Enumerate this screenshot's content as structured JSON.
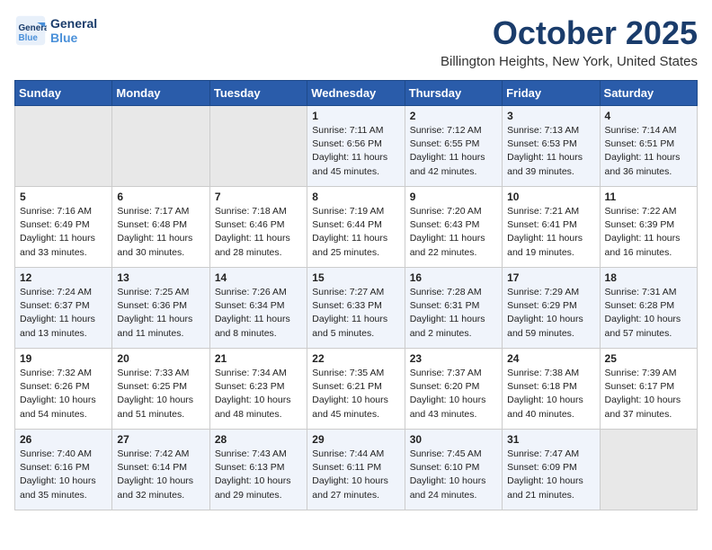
{
  "logo": {
    "line1": "General",
    "line2": "Blue"
  },
  "title": "October 2025",
  "location": "Billington Heights, New York, United States",
  "days_header": [
    "Sunday",
    "Monday",
    "Tuesday",
    "Wednesday",
    "Thursday",
    "Friday",
    "Saturday"
  ],
  "weeks": [
    [
      {
        "day": "",
        "info": ""
      },
      {
        "day": "",
        "info": ""
      },
      {
        "day": "",
        "info": ""
      },
      {
        "day": "1",
        "info": "Sunrise: 7:11 AM\nSunset: 6:56 PM\nDaylight: 11 hours and 45 minutes."
      },
      {
        "day": "2",
        "info": "Sunrise: 7:12 AM\nSunset: 6:55 PM\nDaylight: 11 hours and 42 minutes."
      },
      {
        "day": "3",
        "info": "Sunrise: 7:13 AM\nSunset: 6:53 PM\nDaylight: 11 hours and 39 minutes."
      },
      {
        "day": "4",
        "info": "Sunrise: 7:14 AM\nSunset: 6:51 PM\nDaylight: 11 hours and 36 minutes."
      }
    ],
    [
      {
        "day": "5",
        "info": "Sunrise: 7:16 AM\nSunset: 6:49 PM\nDaylight: 11 hours and 33 minutes."
      },
      {
        "day": "6",
        "info": "Sunrise: 7:17 AM\nSunset: 6:48 PM\nDaylight: 11 hours and 30 minutes."
      },
      {
        "day": "7",
        "info": "Sunrise: 7:18 AM\nSunset: 6:46 PM\nDaylight: 11 hours and 28 minutes."
      },
      {
        "day": "8",
        "info": "Sunrise: 7:19 AM\nSunset: 6:44 PM\nDaylight: 11 hours and 25 minutes."
      },
      {
        "day": "9",
        "info": "Sunrise: 7:20 AM\nSunset: 6:43 PM\nDaylight: 11 hours and 22 minutes."
      },
      {
        "day": "10",
        "info": "Sunrise: 7:21 AM\nSunset: 6:41 PM\nDaylight: 11 hours and 19 minutes."
      },
      {
        "day": "11",
        "info": "Sunrise: 7:22 AM\nSunset: 6:39 PM\nDaylight: 11 hours and 16 minutes."
      }
    ],
    [
      {
        "day": "12",
        "info": "Sunrise: 7:24 AM\nSunset: 6:37 PM\nDaylight: 11 hours and 13 minutes."
      },
      {
        "day": "13",
        "info": "Sunrise: 7:25 AM\nSunset: 6:36 PM\nDaylight: 11 hours and 11 minutes."
      },
      {
        "day": "14",
        "info": "Sunrise: 7:26 AM\nSunset: 6:34 PM\nDaylight: 11 hours and 8 minutes."
      },
      {
        "day": "15",
        "info": "Sunrise: 7:27 AM\nSunset: 6:33 PM\nDaylight: 11 hours and 5 minutes."
      },
      {
        "day": "16",
        "info": "Sunrise: 7:28 AM\nSunset: 6:31 PM\nDaylight: 11 hours and 2 minutes."
      },
      {
        "day": "17",
        "info": "Sunrise: 7:29 AM\nSunset: 6:29 PM\nDaylight: 10 hours and 59 minutes."
      },
      {
        "day": "18",
        "info": "Sunrise: 7:31 AM\nSunset: 6:28 PM\nDaylight: 10 hours and 57 minutes."
      }
    ],
    [
      {
        "day": "19",
        "info": "Sunrise: 7:32 AM\nSunset: 6:26 PM\nDaylight: 10 hours and 54 minutes."
      },
      {
        "day": "20",
        "info": "Sunrise: 7:33 AM\nSunset: 6:25 PM\nDaylight: 10 hours and 51 minutes."
      },
      {
        "day": "21",
        "info": "Sunrise: 7:34 AM\nSunset: 6:23 PM\nDaylight: 10 hours and 48 minutes."
      },
      {
        "day": "22",
        "info": "Sunrise: 7:35 AM\nSunset: 6:21 PM\nDaylight: 10 hours and 45 minutes."
      },
      {
        "day": "23",
        "info": "Sunrise: 7:37 AM\nSunset: 6:20 PM\nDaylight: 10 hours and 43 minutes."
      },
      {
        "day": "24",
        "info": "Sunrise: 7:38 AM\nSunset: 6:18 PM\nDaylight: 10 hours and 40 minutes."
      },
      {
        "day": "25",
        "info": "Sunrise: 7:39 AM\nSunset: 6:17 PM\nDaylight: 10 hours and 37 minutes."
      }
    ],
    [
      {
        "day": "26",
        "info": "Sunrise: 7:40 AM\nSunset: 6:16 PM\nDaylight: 10 hours and 35 minutes."
      },
      {
        "day": "27",
        "info": "Sunrise: 7:42 AM\nSunset: 6:14 PM\nDaylight: 10 hours and 32 minutes."
      },
      {
        "day": "28",
        "info": "Sunrise: 7:43 AM\nSunset: 6:13 PM\nDaylight: 10 hours and 29 minutes."
      },
      {
        "day": "29",
        "info": "Sunrise: 7:44 AM\nSunset: 6:11 PM\nDaylight: 10 hours and 27 minutes."
      },
      {
        "day": "30",
        "info": "Sunrise: 7:45 AM\nSunset: 6:10 PM\nDaylight: 10 hours and 24 minutes."
      },
      {
        "day": "31",
        "info": "Sunrise: 7:47 AM\nSunset: 6:09 PM\nDaylight: 10 hours and 21 minutes."
      },
      {
        "day": "",
        "info": ""
      }
    ]
  ]
}
